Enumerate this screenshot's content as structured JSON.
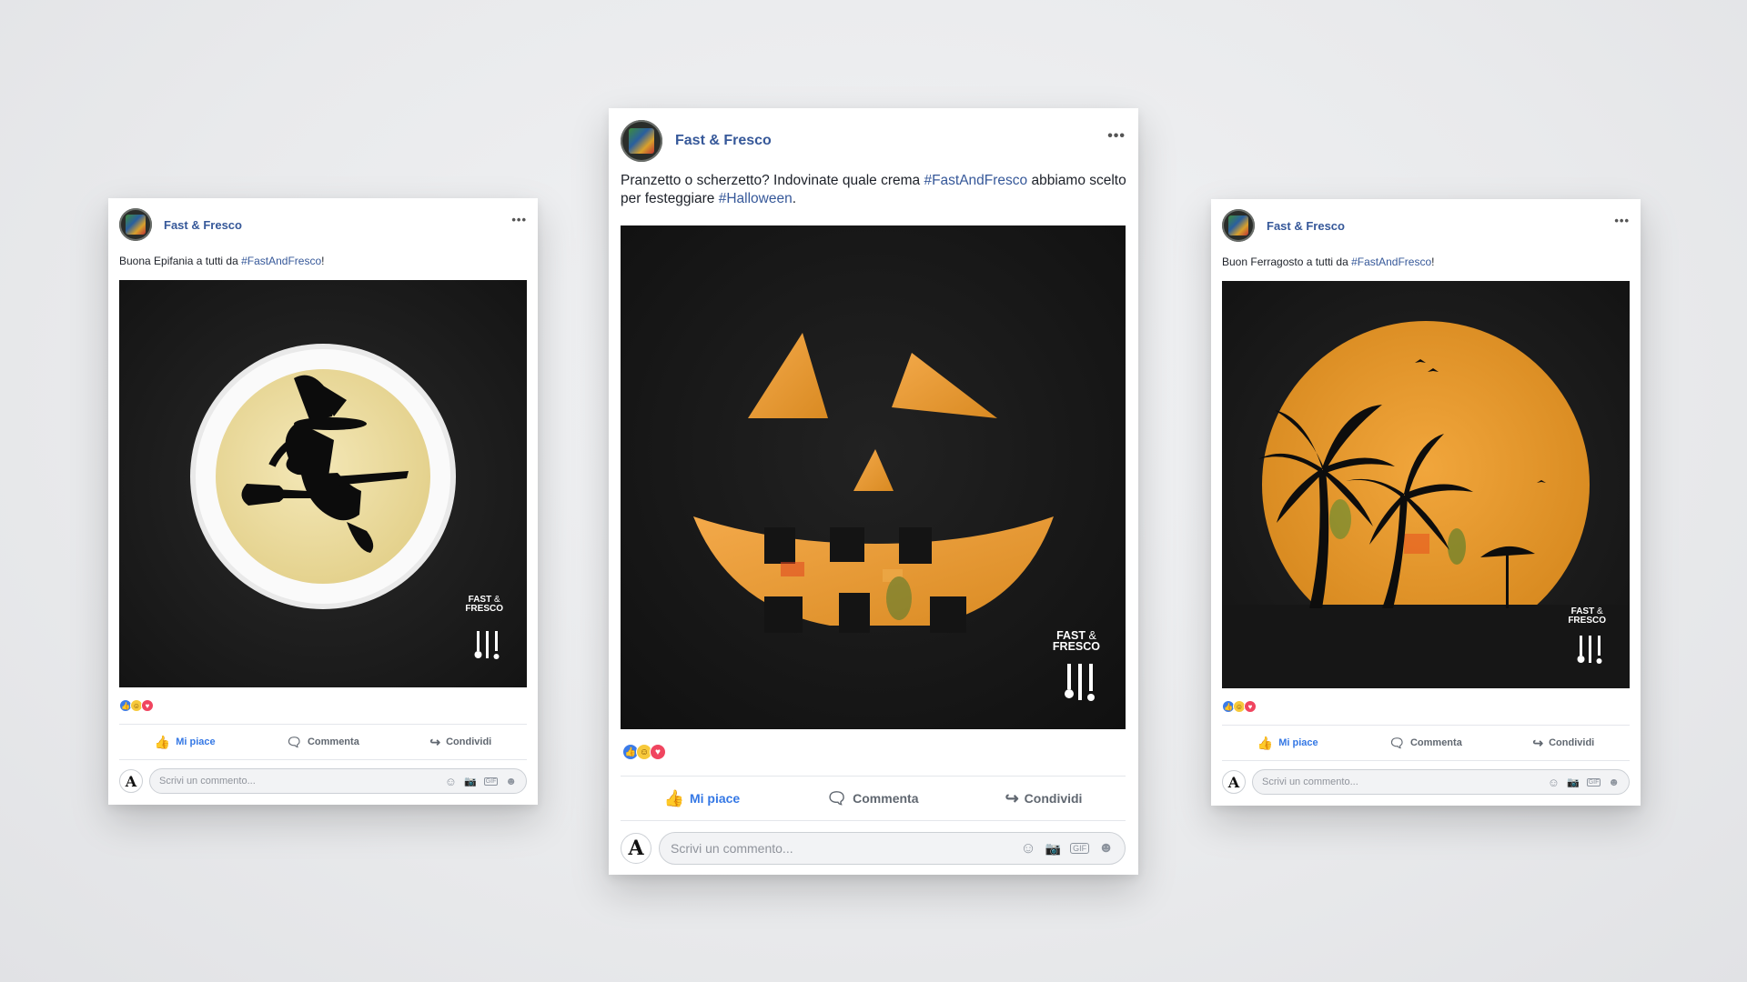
{
  "posts": [
    {
      "page_name": "Fast & Fresco",
      "text_before": "Buona Epifania a tutti da ",
      "hashtag1": "#FastAndFresco",
      "text_mid": "!",
      "hashtag2": "",
      "text_after": "",
      "image": "witch-soup-bowl",
      "actions": {
        "like": "Mi piace",
        "comment": "Commenta",
        "share": "Condividi"
      },
      "comment_placeholder": "Scrivi un commento..."
    },
    {
      "page_name": "Fast & Fresco",
      "text_before": "Pranzetto o scherzetto? Indovinate quale crema ",
      "hashtag1": "#FastAndFresco",
      "text_mid": " abbiamo scelto per festeggiare ",
      "hashtag2": "#Halloween",
      "text_after": ".",
      "image": "pumpkin-face",
      "actions": {
        "like": "Mi piace",
        "comment": "Commenta",
        "share": "Condividi"
      },
      "comment_placeholder": "Scrivi un commento..."
    },
    {
      "page_name": "Fast & Fresco",
      "text_before": "Buon Ferragosto a tutti da ",
      "hashtag1": "#FastAndFresco",
      "text_mid": "!",
      "hashtag2": "",
      "text_after": "",
      "image": "palm-sunset-soup",
      "actions": {
        "like": "Mi piace",
        "comment": "Commenta",
        "share": "Condividi"
      },
      "comment_placeholder": "Scrivi un commento..."
    }
  ],
  "brand": {
    "line1": "FAST",
    "amp": "&",
    "line2": "FRESCO"
  },
  "comment_icons": [
    "emoji-icon",
    "camera-icon",
    "gif-icon",
    "sticker-icon"
  ],
  "gif_label": "GIF",
  "colors": {
    "link": "#365899",
    "like_active": "#3578e5",
    "photo_bg": "#161616",
    "soup_orange": "#e8972a",
    "soup_cream": "#efe2a8"
  }
}
